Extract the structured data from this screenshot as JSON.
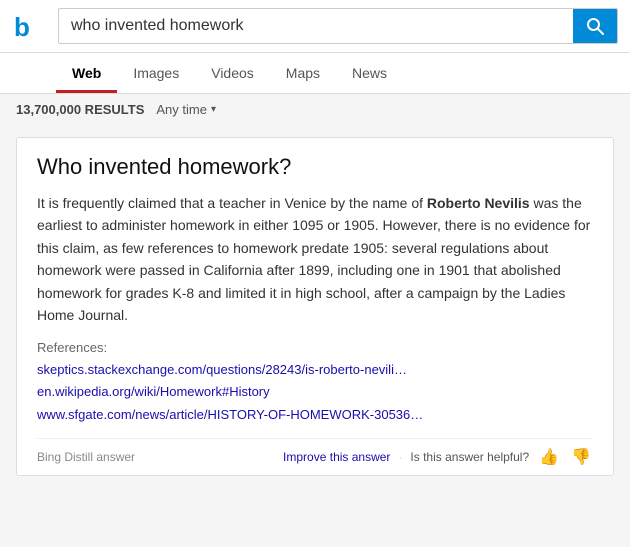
{
  "header": {
    "search_query": "who invented homework",
    "search_button_label": "🔍"
  },
  "nav": {
    "tabs": [
      {
        "id": "web",
        "label": "Web",
        "active": true
      },
      {
        "id": "images",
        "label": "Images",
        "active": false
      },
      {
        "id": "videos",
        "label": "Videos",
        "active": false
      },
      {
        "id": "maps",
        "label": "Maps",
        "active": false
      },
      {
        "id": "news",
        "label": "News",
        "active": false
      }
    ]
  },
  "filter_bar": {
    "result_count": "13,700,000 RESULTS",
    "time_filter": "Any time"
  },
  "answer_card": {
    "title": "Who invented homework?",
    "body_parts": [
      {
        "type": "text",
        "content": "It is frequently claimed that a teacher in Venice by the name of "
      },
      {
        "type": "bold",
        "content": "Roberto Nevilis"
      },
      {
        "type": "text",
        "content": " was the earliest to administer homework in either 1095 or 1905. However, there is no evidence for this claim, as few references to homework predate 1905: several regulations about homework were passed in California after 1899, including one in 1901 that abolished homework for grades K-8 and limited it in high school, after a campaign by the Ladies Home Journal."
      }
    ],
    "references_label": "References:",
    "references": [
      "skeptics.stackexchange.com/questions/28243/is-roberto-nevili…",
      "en.wikipedia.org/wiki/Homework#History",
      "www.sfgate.com/news/article/HISTORY-OF-HOMEWORK-30536…"
    ],
    "footer": {
      "source_label": "Bing Distill answer",
      "improve_label": "Improve this answer",
      "helpful_label": "Is this answer helpful?",
      "separator": "·"
    }
  }
}
